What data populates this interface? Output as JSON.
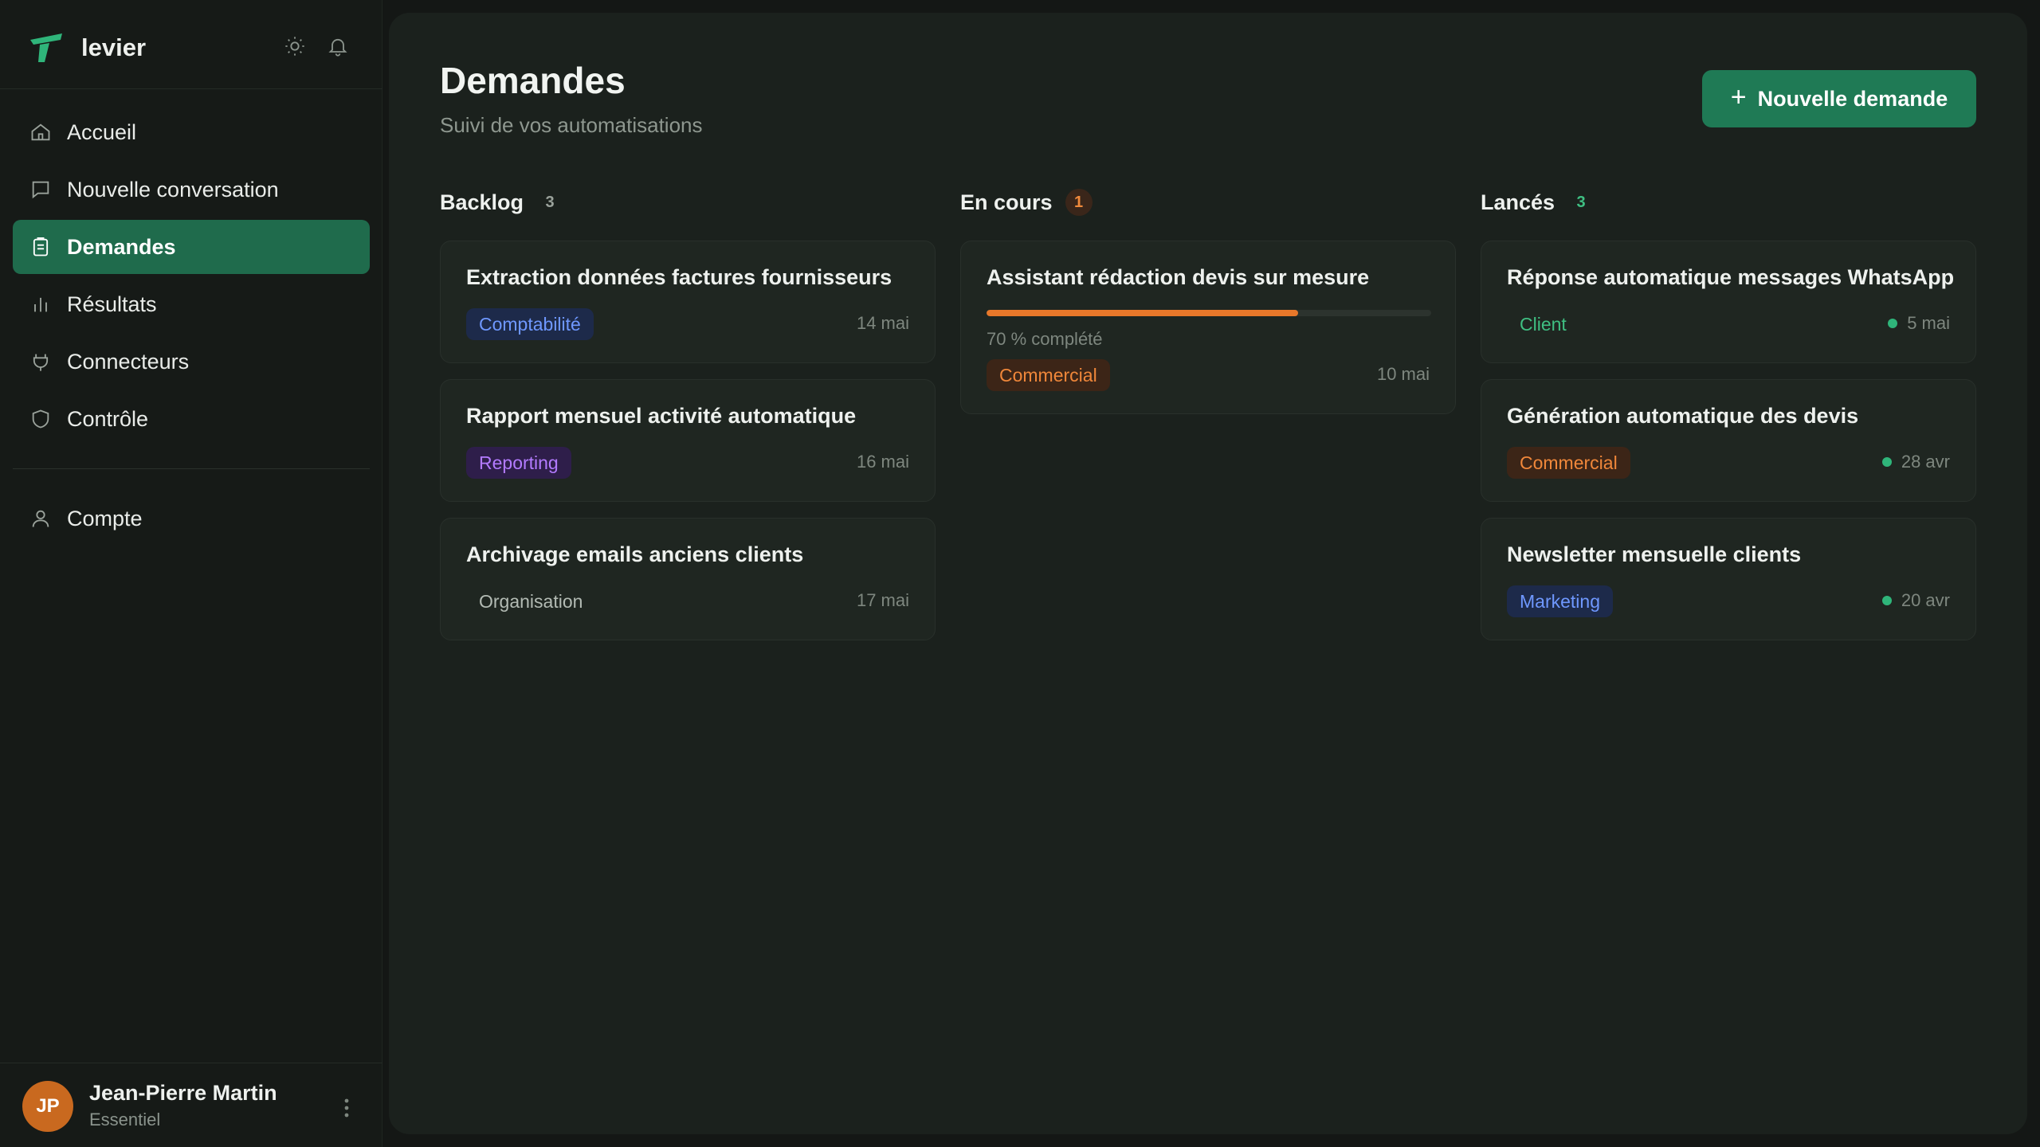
{
  "brand": {
    "name": "levier"
  },
  "nav": {
    "items": [
      {
        "label": "Accueil",
        "icon": "home-icon",
        "active": false
      },
      {
        "label": "Nouvelle conversation",
        "icon": "chat-icon",
        "active": false
      },
      {
        "label": "Demandes",
        "icon": "clipboard-icon",
        "active": true
      },
      {
        "label": "Résultats",
        "icon": "bar-chart-icon",
        "active": false
      },
      {
        "label": "Connecteurs",
        "icon": "plug-icon",
        "active": false
      },
      {
        "label": "Contrôle",
        "icon": "shield-icon",
        "active": false
      }
    ],
    "account": {
      "label": "Compte",
      "icon": "user-icon"
    }
  },
  "user": {
    "initials": "JP",
    "name": "Jean-Pierre Martin",
    "plan": "Essentiel"
  },
  "page": {
    "title": "Demandes",
    "subtitle": "Suivi de vos automatisations",
    "new_button": "Nouvelle demande"
  },
  "columns": [
    {
      "title": "Backlog",
      "count": "3",
      "cards": [
        {
          "title": "Extraction données factures fournisseurs",
          "tag": "Comptabilité",
          "tag_color": "blue",
          "date": "14 mai"
        },
        {
          "title": "Rapport mensuel activité automatique",
          "tag": "Reporting",
          "tag_color": "purple",
          "date": "16 mai"
        },
        {
          "title": "Archivage emails anciens clients",
          "tag": "Organisation",
          "tag_color": "plain",
          "date": "17 mai"
        }
      ]
    },
    {
      "title": "En cours",
      "count": "1",
      "cards": [
        {
          "title": "Assistant rédaction devis sur mesure",
          "tag": "Commercial",
          "tag_color": "orange",
          "date": "10 mai",
          "progress": 0.7,
          "progress_text": "70 % complété"
        }
      ]
    },
    {
      "title": "Lancés",
      "count": "3",
      "cards": [
        {
          "title": "Réponse automatique messages WhatsApp",
          "tag": "Client",
          "tag_color": "green",
          "date": "5 mai"
        },
        {
          "title": "Génération automatique des devis",
          "tag": "Commercial",
          "tag_color": "orange",
          "date": "28 avr"
        },
        {
          "title": "Newsletter mensuelle clients",
          "tag": "Marketing",
          "tag_color": "blue",
          "date": "20 avr"
        }
      ]
    }
  ],
  "colors": {
    "accent": "#1f7a55",
    "active_nav": "#1f6b4c",
    "progress": "#e8782a",
    "avatar": "#c9691f"
  }
}
